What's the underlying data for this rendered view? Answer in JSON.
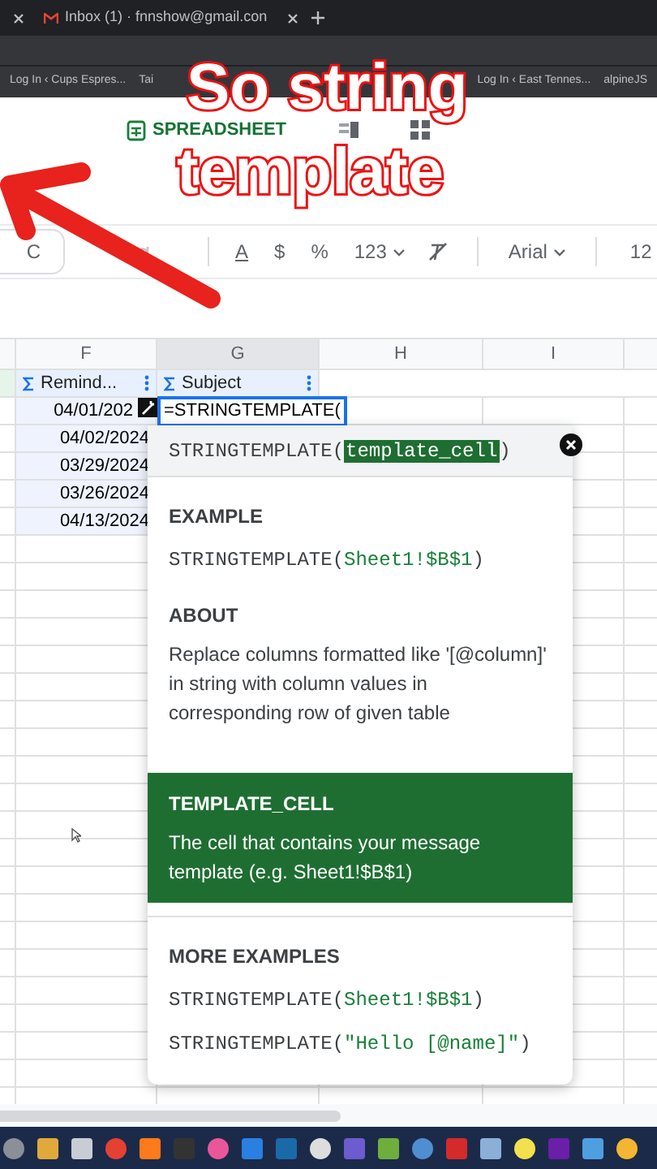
{
  "browser": {
    "tab": "Inbox (1) · fnnshow@gmail.con",
    "bookmarks": [
      {
        "label": "Log In ‹ Cups Espres..."
      },
      {
        "label": "Tai"
      },
      {
        "label": "Log In ‹ East Tennes..."
      },
      {
        "label": "alpineJS"
      }
    ]
  },
  "app": {
    "title": "SPREADSHEET"
  },
  "toolbar": {
    "undo": "C",
    "items": [
      "A",
      "$",
      "%"
    ],
    "number_format": "123",
    "font": "Arial",
    "size": "12"
  },
  "sheet": {
    "columns": [
      "F",
      "G",
      "H",
      "I"
    ],
    "headers": [
      {
        "label": "Remind..."
      },
      {
        "label": "Subject"
      }
    ],
    "editing": "=STRINGTEMPLATE(",
    "rows": [
      "04/01/202",
      "04/02/2024",
      "03/29/2024",
      "03/26/2024",
      "04/13/2024"
    ]
  },
  "popup": {
    "signature": {
      "fn": "STRINGTEMPLATE(",
      "arg": "template_cell",
      "close": ")"
    },
    "sections": [
      {
        "kind": "example",
        "title": "EXAMPLE",
        "lines": [
          {
            "fn": "STRINGTEMPLATE(",
            "arg": "Sheet1!$B$1",
            "close": ")"
          }
        ]
      },
      {
        "kind": "text",
        "title": "ABOUT",
        "body": "Replace columns formatted like '[@column]' in string with column values in corresponding row of given table",
        "selected": false
      },
      {
        "kind": "text",
        "title": "TEMPLATE_CELL",
        "body": "The cell that contains your message template (e.g. Sheet1!$B$1)",
        "selected": true
      },
      {
        "kind": "example",
        "title": "MORE EXAMPLES",
        "lines": [
          {
            "fn": "STRINGTEMPLATE(",
            "arg": "Sheet1!$B$1",
            "close": ")"
          },
          {
            "fn": "STRINGTEMPLATE(",
            "arg": "\"Hello [@name]\"",
            "close": ")"
          }
        ]
      }
    ]
  },
  "caption": [
    "So string",
    "template"
  ]
}
